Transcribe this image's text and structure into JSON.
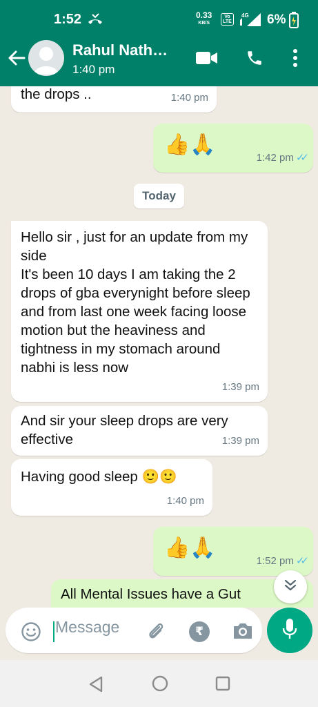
{
  "status_bar": {
    "time": "1:52",
    "net_speed": "0.33",
    "net_unit": "KB/S",
    "volte": "Vo LTE",
    "network": "4G",
    "battery": "6%"
  },
  "header": {
    "contact_name": "Rahul Nath…",
    "last_seen": "1:40 pm"
  },
  "chat": {
    "date_chip": "Today",
    "messages": [
      {
        "direction": "in",
        "text": "the drops ..",
        "time": "1:40 pm"
      },
      {
        "direction": "out",
        "text": "👍🙏",
        "time": "1:42 pm",
        "status": "read"
      },
      {
        "direction": "in",
        "text": "Hello sir , just for an update from my side\nIt's been 10 days I am taking the 2 drops of gba everynight before sleep and from last one week facing loose motion but the heaviness and tightness in my stomach around nabhi is less now",
        "time": "1:39 pm"
      },
      {
        "direction": "in",
        "text": "And sir your sleep drops are very effective",
        "time": "1:39 pm"
      },
      {
        "direction": "in",
        "text": "Having good sleep 🙂🙂",
        "time": "1:40 pm"
      },
      {
        "direction": "out",
        "text": "👍🙏",
        "time": "1:52 pm",
        "status": "read"
      },
      {
        "direction": "out",
        "text": "All Mental Issues have a Gut",
        "time": ""
      }
    ]
  },
  "input": {
    "placeholder": "Message"
  },
  "icons": {
    "back": "arrow-left-icon",
    "video": "video-call-icon",
    "call": "phone-icon",
    "menu": "more-vert-icon",
    "emoji": "emoji-icon",
    "attach": "paperclip-icon",
    "payment": "rupee-icon",
    "camera": "camera-icon",
    "mic": "mic-icon",
    "scroll_down": "double-chevron-down-icon"
  },
  "colors": {
    "header": "#008069",
    "outgoing_bubble": "#dcf8c6",
    "incoming_bubble": "#ffffff",
    "accent": "#00a884",
    "read_ticks": "#53bdeb"
  }
}
